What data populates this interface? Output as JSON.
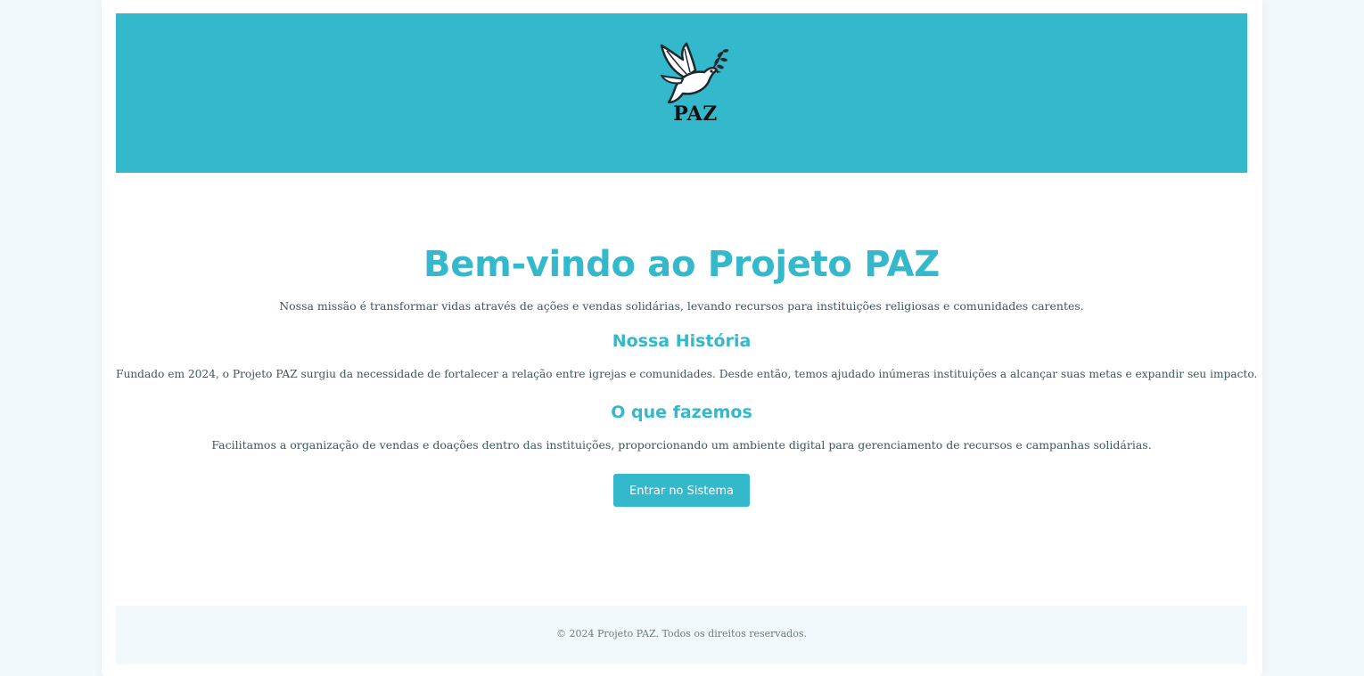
{
  "header": {
    "logo_text": "PAZ",
    "logo_icon": "dove-with-olive-branch-icon"
  },
  "main": {
    "title": "Bem-vindo ao Projeto PAZ",
    "mission": "Nossa missão é transformar vidas através de ações e vendas solidárias, levando recursos para instituições religiosas e comunidades carentes.",
    "history_heading": "Nossa História",
    "history_text": "Fundado em 2024, o Projeto PAZ surgiu da necessidade de fortalecer a relação entre igrejas e comunidades. Desde então, temos ajudado inúmeras instituições a alcançar suas metas e expandir seu impacto.",
    "what_heading": "O que fazemos",
    "what_text": "Facilitamos a organização de vendas e doações dentro das instituições, proporcionando um ambiente digital para gerenciamento de recursos e campanhas solidárias.",
    "enter_button": "Entrar no Sistema"
  },
  "footer": {
    "text": "© 2024 Projeto PAZ. Todos os direitos reservados."
  },
  "colors": {
    "accent": "#33b8cc",
    "background": "#f2f9fc",
    "text": "#3f5660"
  }
}
